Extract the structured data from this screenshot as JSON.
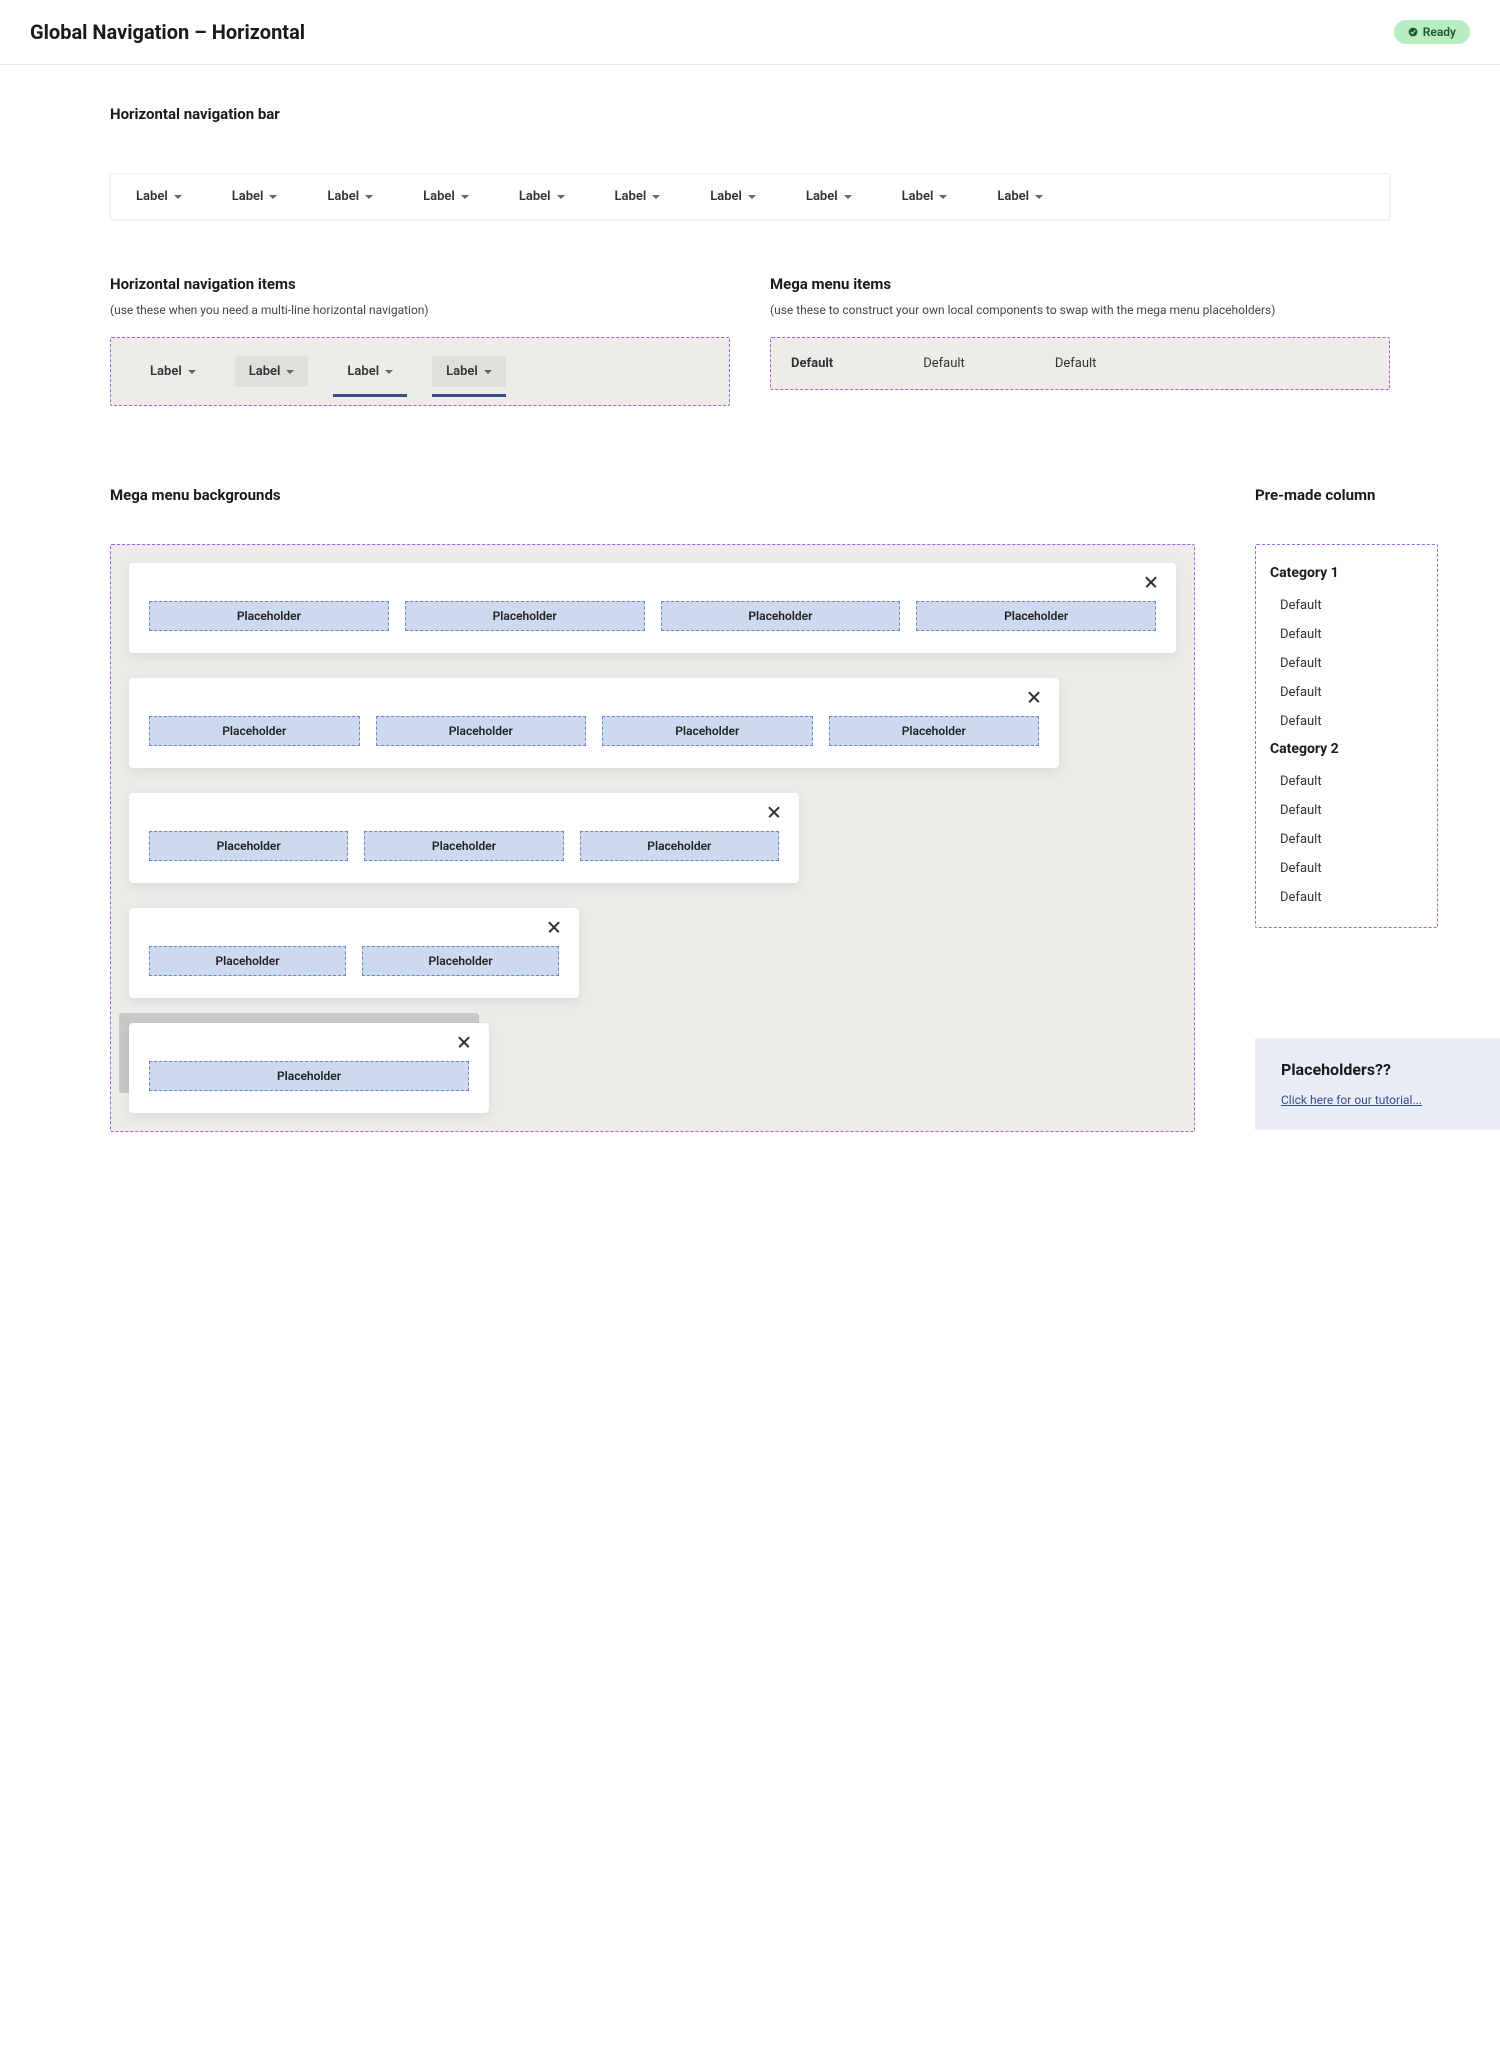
{
  "header": {
    "title": "Global Navigation – Horizontal",
    "status": "Ready"
  },
  "sections": {
    "navbar_title": "Horizontal navigation bar",
    "hnav_items_title": "Horizontal navigation items",
    "hnav_items_sub": "(use these when you need a multi-line horizontal navigation)",
    "mega_items_title": "Mega menu items",
    "mega_items_sub": "(use these to construct your own local components to swap with the mega menu placeholders)",
    "mega_bg_title": "Mega menu backgrounds",
    "premade_title": "Pre-made column"
  },
  "navbar_items": [
    "Label",
    "Label",
    "Label",
    "Label",
    "Label",
    "Label",
    "Label",
    "Label",
    "Label",
    "Label"
  ],
  "hnav_state_items": [
    "Label",
    "Label",
    "Label",
    "Label"
  ],
  "mega_menu_items": [
    "Default",
    "Default",
    "Default"
  ],
  "placeholder_text": "Placeholder",
  "premade": {
    "cat1_title": "Category 1",
    "cat1_items": [
      "Default",
      "Default",
      "Default",
      "Default",
      "Default"
    ],
    "cat2_title": "Category 2",
    "cat2_items": [
      "Default",
      "Default",
      "Default",
      "Default",
      "Default"
    ]
  },
  "promo": {
    "title": "Placeholders??",
    "link": "Click here for our tutorial..."
  }
}
